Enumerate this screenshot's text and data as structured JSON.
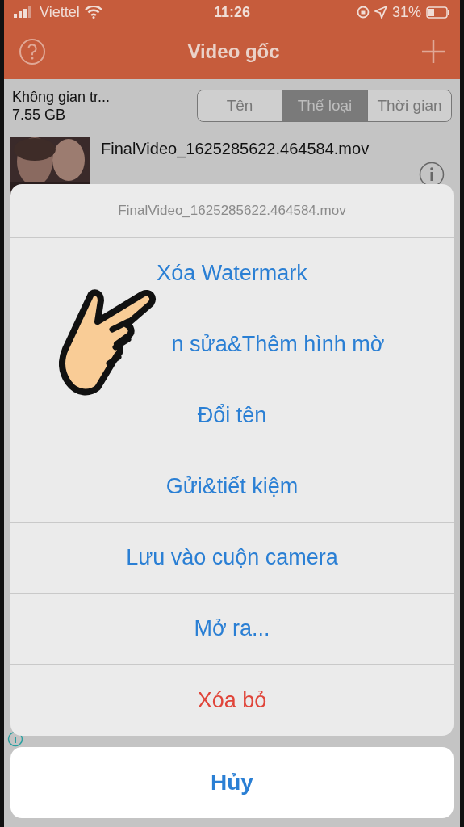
{
  "status_bar": {
    "carrier": "Viettel",
    "time": "11:26",
    "battery": "31%"
  },
  "nav": {
    "title": "Video gốc"
  },
  "storage": {
    "label": "Không gian tr...",
    "value": "7.55 GB"
  },
  "sort_tabs": [
    {
      "label": "Tên",
      "selected": false
    },
    {
      "label": "Thể loại",
      "selected": true
    },
    {
      "label": "Thời gian",
      "selected": false
    }
  ],
  "video": {
    "name": "FinalVideo_1625285622.464584.mov"
  },
  "action_sheet": {
    "title": "FinalVideo_1625285622.464584.mov",
    "actions": [
      {
        "label": "Xóa Watermark",
        "kind": "default"
      },
      {
        "label": "n sửa&Thêm hình mờ",
        "kind": "default"
      },
      {
        "label": "Đổi tên",
        "kind": "default"
      },
      {
        "label": "Gửi&tiết kiệm",
        "kind": "default"
      },
      {
        "label": "Lưu vào cuộn camera",
        "kind": "default"
      },
      {
        "label": "Mở ra...",
        "kind": "default"
      },
      {
        "label": "Xóa bỏ",
        "kind": "destructive"
      }
    ],
    "cancel": "Hủy"
  }
}
